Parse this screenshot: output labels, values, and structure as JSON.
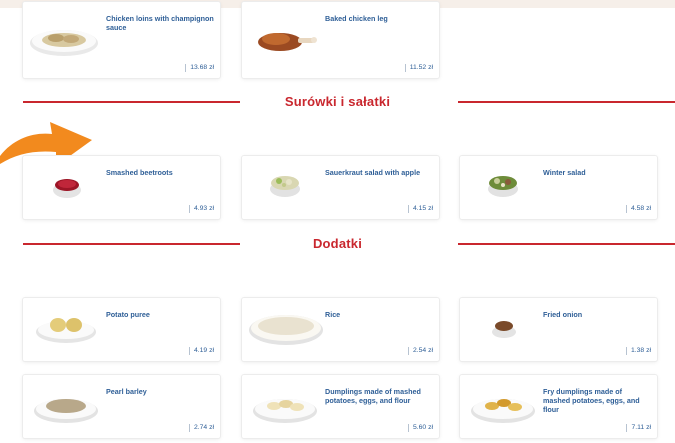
{
  "sections": [
    {
      "title": ""
    },
    {
      "title": "Surówki i sałatki"
    },
    {
      "title": "Dodatki"
    }
  ],
  "items": [
    {
      "name": "Chicken loins with champignon sauce",
      "price": "13.68 zł",
      "icon": "chicken-loins-plate"
    },
    {
      "name": "Baked chicken leg",
      "price": "11.52 zł",
      "icon": "chicken-leg-plate"
    },
    {
      "name": "Smashed beetroots",
      "price": "4.93 zł",
      "icon": "beetroot-bowl"
    },
    {
      "name": "Sauerkraut salad with apple",
      "price": "4.15 zł",
      "icon": "sauerkraut-bowl"
    },
    {
      "name": "Winter salad",
      "price": "4.58 zł",
      "icon": "salad-bowl"
    },
    {
      "name": "Potato puree",
      "price": "4.19 zł",
      "icon": "potato-puree-plate"
    },
    {
      "name": "Rice",
      "price": "2.54 zł",
      "icon": "rice-plate"
    },
    {
      "name": "Fried onion",
      "price": "1.38 zł",
      "icon": "fried-onion-bowl"
    },
    {
      "name": "Pearl barley",
      "price": "2.74 zł",
      "icon": "barley-plate"
    },
    {
      "name": "Dumplings made of mashed potatoes, eggs, and flour",
      "price": "5.60 zł",
      "icon": "dumplings-plate"
    },
    {
      "name": "Fry dumplings made of mashed potatoes, eggs, and flour",
      "price": "7.11 zł",
      "icon": "fried-dumplings-plate"
    }
  ],
  "colors": {
    "accent": "#c9272e",
    "link": "#2f5f97",
    "arrow": "#f28a1e"
  }
}
